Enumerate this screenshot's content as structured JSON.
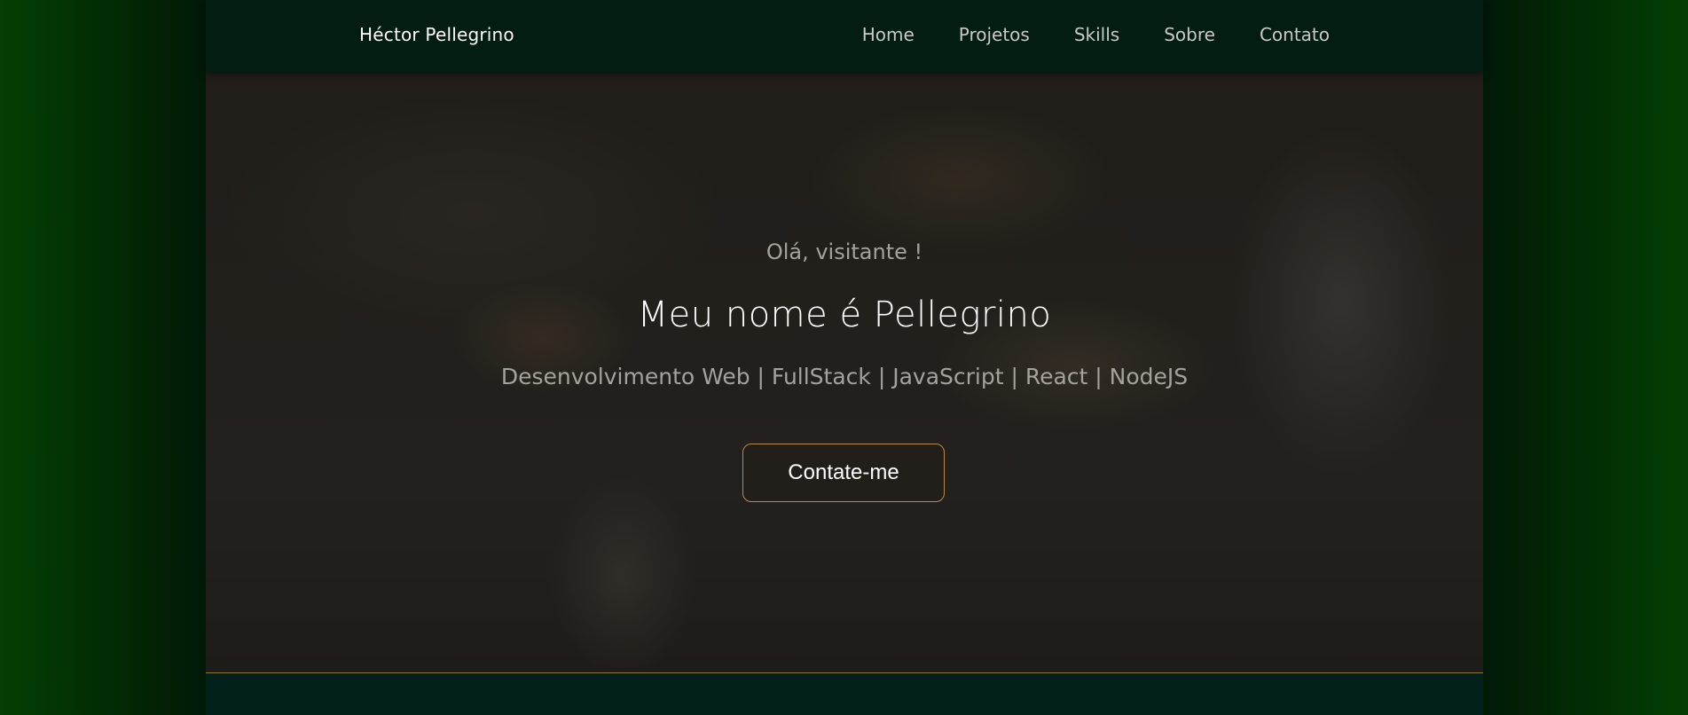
{
  "navbar": {
    "brand": "Héctor Pellegrino",
    "links": [
      {
        "label": "Home"
      },
      {
        "label": "Projetos"
      },
      {
        "label": "Skills"
      },
      {
        "label": "Sobre"
      },
      {
        "label": "Contato"
      }
    ]
  },
  "hero": {
    "greeting": "Olá, visitante !",
    "title": "Meu nome é Pellegrino",
    "subtitle": "Desenvolvimento Web | FullStack | JavaScript | React | NodeJS",
    "cta_label": "Contate-me"
  },
  "colors": {
    "accent_gold": "#b88a4f",
    "navbar_bg": "#031d13",
    "outer_green": "#043f04"
  }
}
